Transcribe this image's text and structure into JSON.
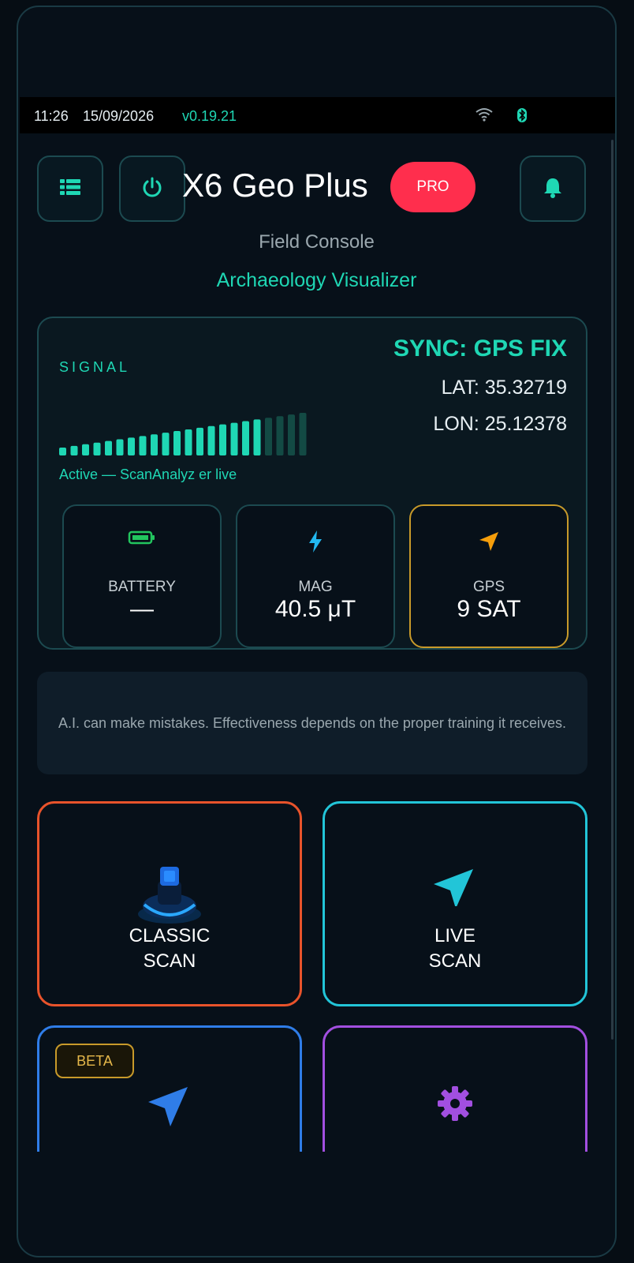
{
  "status_bar": {
    "time": "11:26",
    "date": "15/09/2026",
    "version": "v0.19.21",
    "icons": [
      "wifi-icon",
      "bluetooth-icon"
    ]
  },
  "header": {
    "menu_icon": "grid-menu-icon",
    "power_icon": "power-icon",
    "title": "X6 Geo Plus",
    "badge": "PRO",
    "bell_icon": "bell-icon",
    "subtitle": "Field Console",
    "tagline": "Archaeology Visualizer"
  },
  "signal_panel": {
    "label": "SIGNAL",
    "sync_status": "SYNC: GPS FIX",
    "lat": "LAT: 35.32719",
    "lon": "LON: 25.12378",
    "bars_total": 22,
    "bars_active": 18,
    "status_text": "Active — ScanAnalyz er live"
  },
  "stats": [
    {
      "label": "BATTERY",
      "value": "—",
      "icon": "battery-icon",
      "color": "#22c55e"
    },
    {
      "label": "MAG",
      "value": "40.5 μT",
      "icon": "bolt-icon",
      "color": "#22b8f0"
    },
    {
      "label": "GPS",
      "value": "9 SAT",
      "icon": "location-arrow-icon",
      "color": "#f59e0b"
    }
  ],
  "notice": "A.I. can make mistakes. Effectiveness depends on the proper training it receives.",
  "tiles": [
    {
      "line1": "CLASSIC",
      "line2": "SCAN",
      "icon": "scanner-device-icon",
      "border": "#e8532b"
    },
    {
      "line1": "LIVE",
      "line2": "SCAN",
      "icon": "navigation-arrow-icon",
      "border": "#22c5d8"
    },
    {
      "line1": "",
      "line2": "",
      "icon": "navigation-arrow-icon",
      "border": "#2f7de8",
      "badge": "BETA"
    },
    {
      "line1": "",
      "line2": "",
      "icon": "gear-icon",
      "border": "#a24fe0"
    }
  ],
  "colors": {
    "accent": "#1fd7b4",
    "background": "#071019",
    "pro_badge": "#ff2e4d"
  }
}
